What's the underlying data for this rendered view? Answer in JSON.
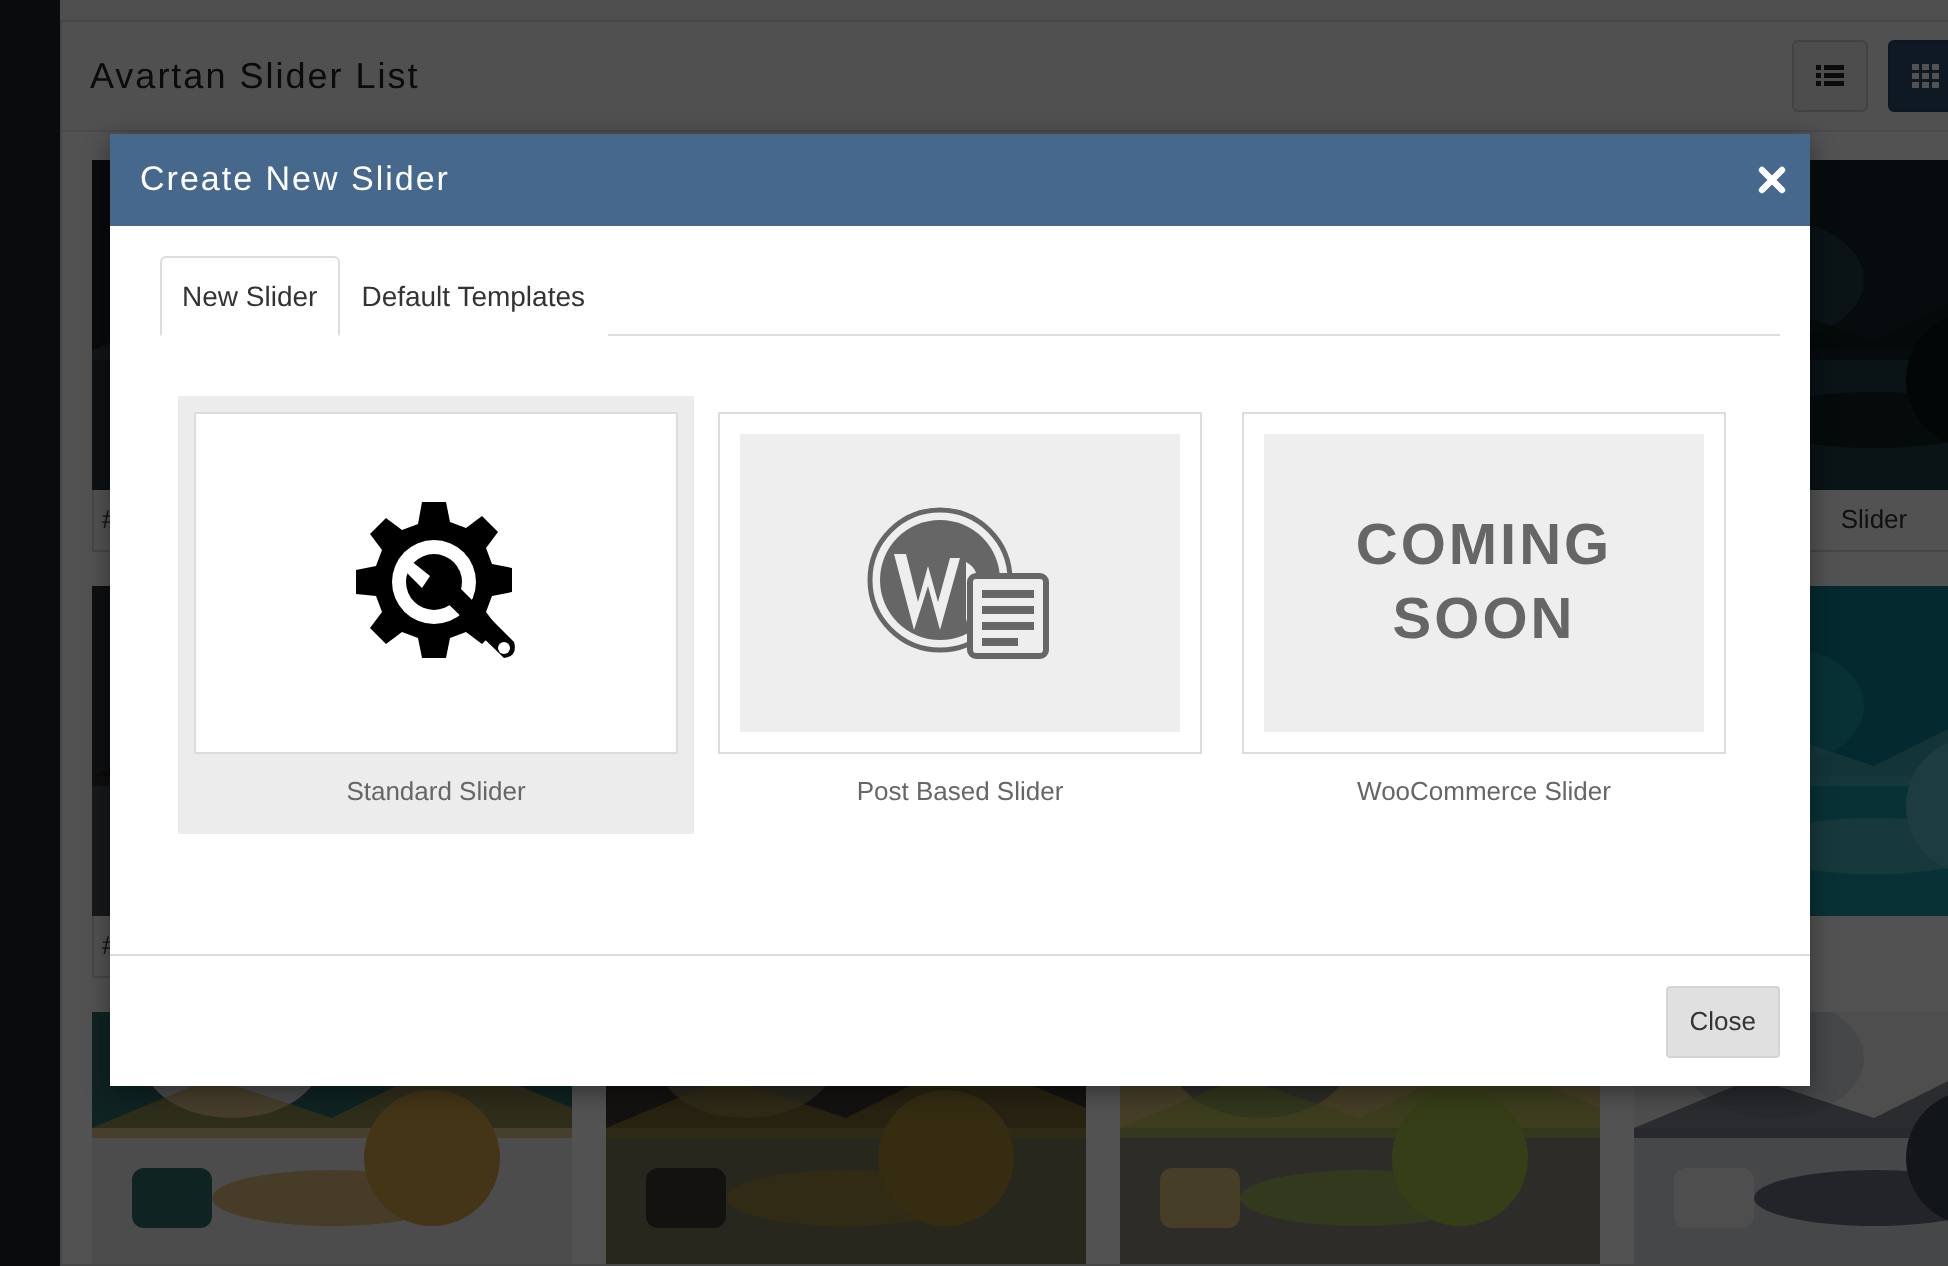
{
  "page": {
    "title": "Avartan Slider List",
    "view_buttons": [
      {
        "kind": "list",
        "selected": false
      },
      {
        "kind": "grid",
        "selected": true
      }
    ],
    "slider_rows": [
      {
        "cards": [
          {
            "kind": "picture",
            "caption": "#"
          },
          {
            "kind": "picture",
            "caption": "Slider"
          }
        ]
      },
      {
        "cards": [
          {
            "kind": "picture",
            "caption": "#"
          },
          {
            "kind": "picture"
          }
        ]
      },
      {
        "cards": [
          {
            "kind": "picture"
          },
          {
            "kind": "picture"
          },
          {
            "kind": "picture"
          },
          {
            "kind": "picture"
          }
        ]
      }
    ]
  },
  "dialog": {
    "title": "Create New Slider",
    "tabs": [
      {
        "label": "New Slider",
        "selected": true
      },
      {
        "label": "Default Templates",
        "selected": false
      }
    ],
    "options": [
      {
        "kind": "standard",
        "label": "Standard Slider",
        "selected": true
      },
      {
        "kind": "post",
        "label": "Post Based Slider",
        "selected": false
      },
      {
        "kind": "coming_soon",
        "label": "WooCommerce Slider",
        "selected": false,
        "placeholder_text": "COMING SOON"
      }
    ],
    "footer_button": "Close"
  }
}
